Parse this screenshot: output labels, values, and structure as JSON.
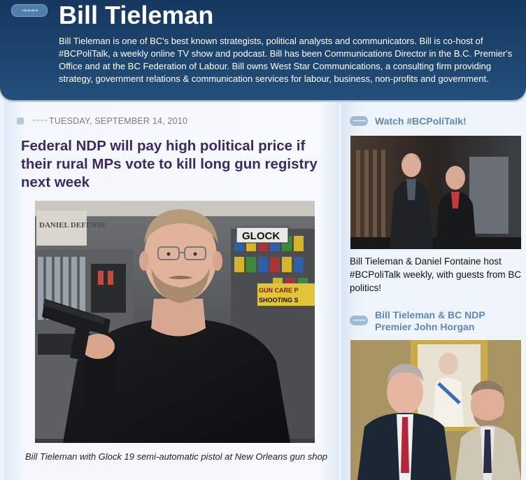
{
  "header": {
    "title": "Bill Tieleman",
    "description": "Bill Tieleman is one of BC's best known strategists, political analysts and communicators. Bill is co-host of #BCPoliTalk, a weekly online TV show and podcast. Bill has been Communications Director in the B.C. Premier's Office and at the BC Federation of Labour. Bill owns West Star Communications, a consulting firm providing strategy, government relations & communication services for labour, business, non-profits and government."
  },
  "post": {
    "date": "TUESDAY, SEPTEMBER 14, 2010",
    "title": "Federal NDP will pay high political price if their rural MPs vote to kill long gun registry next week",
    "photo_caption": "Bill Tieleman with Glock 19 semi-automatic pistol at New Orleans gun shop",
    "photo_signs": {
      "brand": "GLOCK",
      "gun_care": "GUN CARE P",
      "shooting": "SHOOTING S",
      "daniel": "DANIEL DEFENSE"
    }
  },
  "sidebar": {
    "widgets": [
      {
        "heading": "Watch #BCPoliTalk!",
        "text": "Bill Tieleman & Daniel Fontaine host #BCPoliTalk weekly, with guests from BC politics!"
      },
      {
        "heading": "Bill Tieleman & BC NDP Premier John Horgan"
      }
    ]
  },
  "colors": {
    "header_bg": "#1d4670",
    "post_title": "#3d2a63",
    "sidebar_heading": "#5f87b3",
    "page_bg": "#eaf2fb"
  },
  "icons": {
    "header_arrow": "arrow-right-icon",
    "date_bullet": "square-bullet-icon",
    "sidebar_arrow": "arrow-right-icon"
  }
}
